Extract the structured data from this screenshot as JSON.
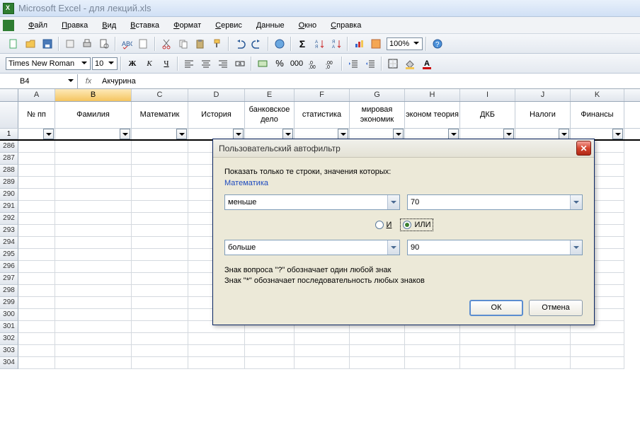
{
  "titlebar": {
    "text": "Microsoft Excel - для лекций.xls"
  },
  "menu": {
    "items": [
      "Файл",
      "Правка",
      "Вид",
      "Вставка",
      "Формат",
      "Сервис",
      "Данные",
      "Окно",
      "Справка"
    ],
    "underlines": [
      "Ф",
      "П",
      "В",
      "В",
      "Ф",
      "С",
      "Д",
      "О",
      "С"
    ]
  },
  "toolbar1": {
    "zoom": "100%"
  },
  "toolbar2": {
    "font": "Times New Roman",
    "size": "10"
  },
  "formula_bar": {
    "name_box": "B4",
    "fx": "fx",
    "formula": "Акчурина"
  },
  "columns": [
    {
      "letter": "A",
      "w": "wA",
      "header": "№ пп"
    },
    {
      "letter": "B",
      "w": "wB",
      "header": "Фамилия",
      "selected": true
    },
    {
      "letter": "C",
      "w": "wC",
      "header": "Математик"
    },
    {
      "letter": "D",
      "w": "wD",
      "header": "История"
    },
    {
      "letter": "E",
      "w": "wE",
      "header": "банковское дело"
    },
    {
      "letter": "F",
      "w": "wF",
      "header": "статистика"
    },
    {
      "letter": "G",
      "w": "wG",
      "header": "мировая экономик"
    },
    {
      "letter": "H",
      "w": "wH",
      "header": "эконом теория"
    },
    {
      "letter": "I",
      "w": "wI",
      "header": "ДКБ"
    },
    {
      "letter": "J",
      "w": "wJ",
      "header": "Налоги"
    },
    {
      "letter": "K",
      "w": "wK",
      "header": "Финансы"
    }
  ],
  "filter_row_num": "1",
  "visible_row_headers": [
    "286",
    "287",
    "288",
    "289",
    "290",
    "291",
    "292",
    "293",
    "294",
    "295",
    "296",
    "297",
    "298",
    "299",
    "300",
    "301",
    "302",
    "303",
    "304"
  ],
  "dialog": {
    "title": "Пользовательский автофильтр",
    "instruction": "Показать только те строки, значения которых:",
    "field": "Математика",
    "op1": "меньше",
    "val1": "70",
    "op2": "больше",
    "val2": "90",
    "radio_and": "И",
    "radio_or": "ИЛИ",
    "hint1": "Знак вопроса \"?\" обозначает один любой знак",
    "hint2": "Знак \"*\" обозначает последовательность любых знаков",
    "ok": "ОК",
    "cancel": "Отмена"
  }
}
